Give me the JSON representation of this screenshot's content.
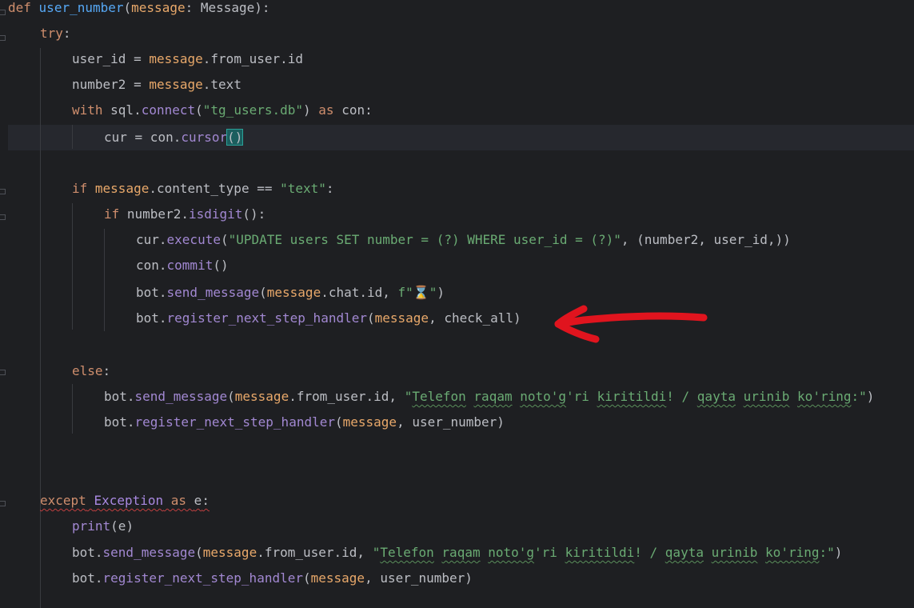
{
  "code": {
    "l1": {
      "kw": "def",
      "fn": "user_number",
      "paren_open": "(",
      "param": "message",
      "colon": ": ",
      "type": "Message",
      "close": "):"
    },
    "l2": {
      "kw": "try",
      "colon": ":"
    },
    "l3": {
      "var": "user_id",
      "eq": " = ",
      "obj": "message",
      "rest": ".from_user.id"
    },
    "l4": {
      "var": "number2",
      "eq": " = ",
      "obj": "message",
      "rest": ".text"
    },
    "l5": {
      "kw": "with",
      "pre": " sql.",
      "call": "connect",
      "open": "(",
      "str": "\"tg_users.db\"",
      "close": ")",
      "as": " as ",
      "con": "con",
      "colon": ":"
    },
    "l6": {
      "var": "cur",
      "eq": " = con.",
      "call": "cursor",
      "brackets": "()"
    },
    "l7": {
      "kw": "if",
      "sp": " ",
      "obj": "message",
      "rest": ".content_type ",
      "op": "==",
      "sp2": " ",
      "str": "\"text\"",
      "colon": ":"
    },
    "l8": {
      "kw": "if",
      "pre": " number2.",
      "call": "isdigit",
      "tail": "():"
    },
    "l9": {
      "pre": "cur.",
      "call": "execute",
      "open": "(",
      "str": "\"UPDATE users SET number = (?) WHERE user_id = (?)\"",
      "tail": ", (number2, user_id,))"
    },
    "l10": {
      "pre": "con.",
      "call": "commit",
      "tail": "()"
    },
    "l11": {
      "pre": "bot.",
      "call": "send_message",
      "open": "(",
      "obj": "message",
      "mid": ".chat.id, ",
      "fstr": "f\"⌛\"",
      "close": ")"
    },
    "l12": {
      "pre": "bot.",
      "call": "register_next_step_handler",
      "open": "(",
      "obj": "message",
      "tail": ", check_all)"
    },
    "l13": {
      "kw": "else",
      "colon": ":"
    },
    "l14": {
      "pre": "bot.",
      "call": "send_message",
      "open": "(",
      "obj": "message",
      "mid": ".from_user.id, ",
      "s1": "\"",
      "w1": "Telefon",
      "sp1": " ",
      "w2": "raqam",
      "sp2": " ",
      "w3": "noto'g",
      "s2": "'ri ",
      "w4": "kiritildi",
      "s3": "! / ",
      "w5": "qayta",
      "sp3": " ",
      "w6": "urinib",
      "sp4": " ",
      "w7": "ko'ring",
      "s4": ":\"",
      "close": ")"
    },
    "l15": {
      "pre": "bot.",
      "call": "register_next_step_handler",
      "open": "(",
      "obj": "message",
      "tail": ", user_number)"
    },
    "l16": {
      "kw": "except",
      "sp": " ",
      "cls": "Exception",
      "as": " as ",
      "e": "e",
      "colon": ":"
    },
    "l17": {
      "call": "print",
      "tail": "(e)"
    },
    "l18": {
      "pre": "bot.",
      "call": "send_message",
      "open": "(",
      "obj": "message",
      "mid": ".from_user.id, ",
      "s1": "\"",
      "w1": "Telefon",
      "sp1": " ",
      "w2": "raqam",
      "sp2": " ",
      "w3": "noto'g",
      "s2": "'ri ",
      "w4": "kiritildi",
      "s3": "! / ",
      "w5": "qayta",
      "sp3": " ",
      "w6": "urinib",
      "sp4": " ",
      "w7": "ko'ring",
      "s4": ":\"",
      "close": ")"
    },
    "l19": {
      "pre": "bot.",
      "call": "register_next_step_handler",
      "open": "(",
      "obj": "message",
      "tail": ", user_number)"
    }
  },
  "colors": {
    "background": "#1e1f22",
    "keyword": "#cf8e6d",
    "function": "#56a8f5",
    "string": "#6aab73",
    "annotation_arrow": "#e0141e"
  }
}
